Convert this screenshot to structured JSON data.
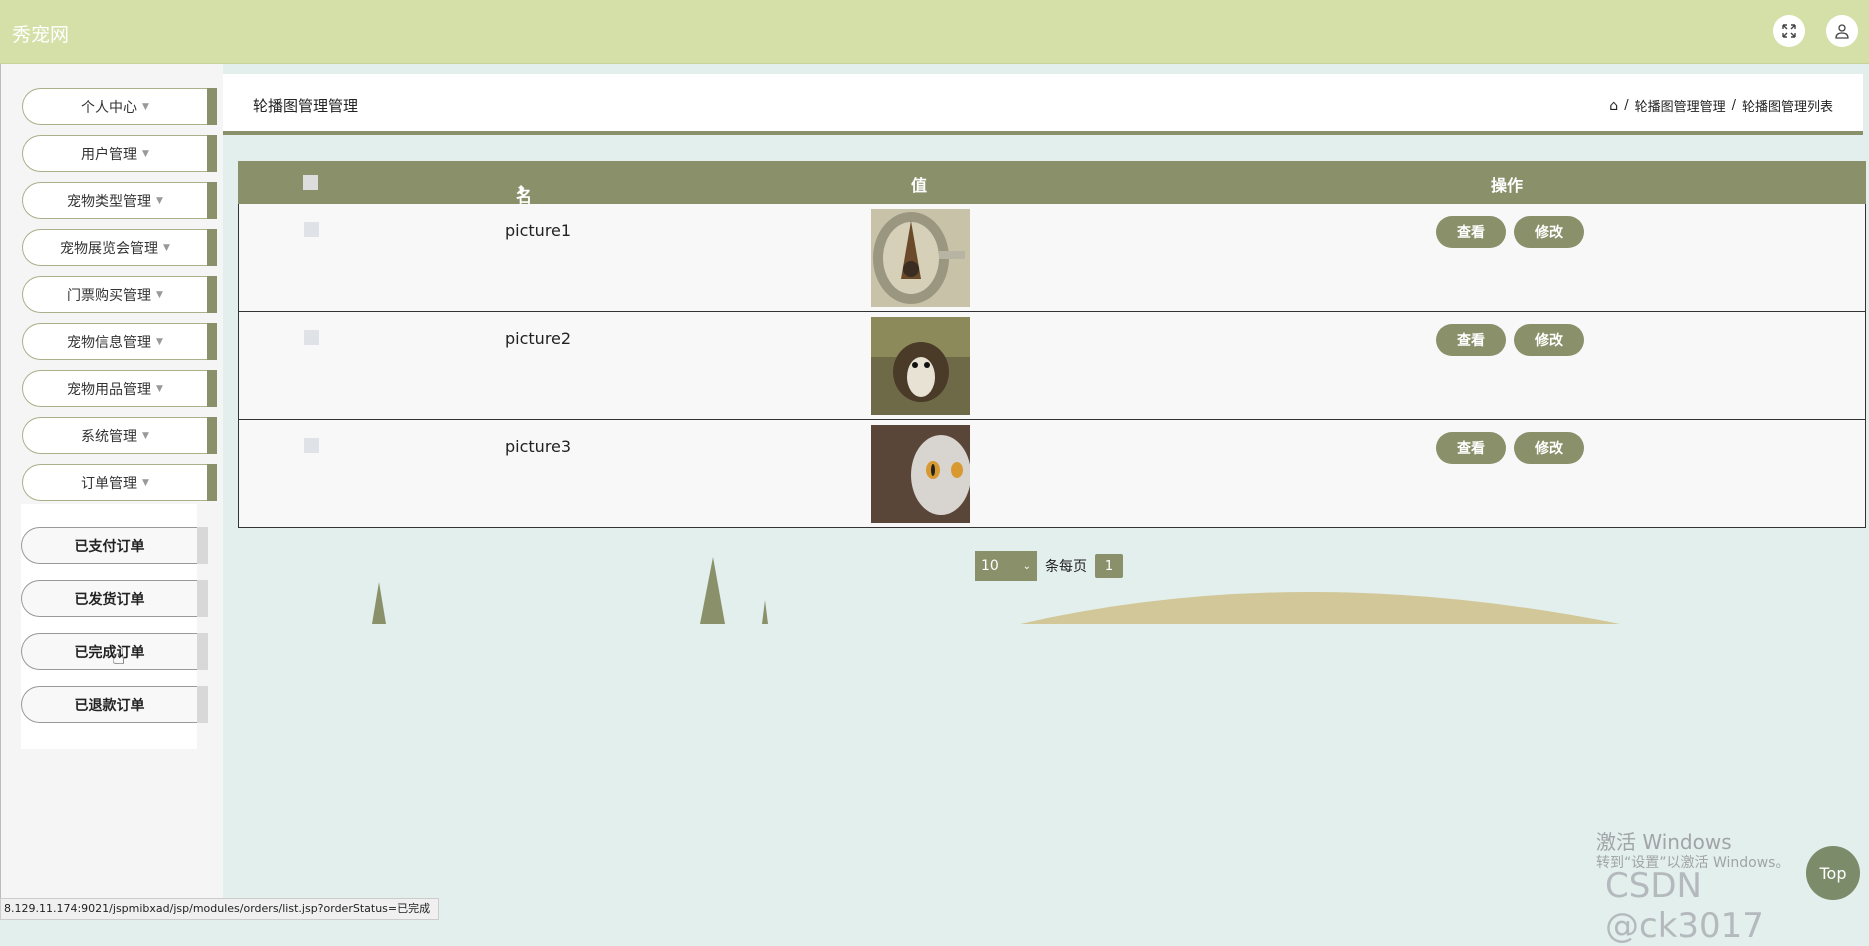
{
  "app": {
    "brand": "秀宠网"
  },
  "topbar": {
    "fullscreen_icon": "fullscreen-icon",
    "user_icon": "user-icon"
  },
  "sidebar": {
    "items": [
      {
        "label": "个人中心"
      },
      {
        "label": "用户管理"
      },
      {
        "label": "宠物类型管理"
      },
      {
        "label": "宠物展览会管理"
      },
      {
        "label": "门票购买管理"
      },
      {
        "label": "宠物信息管理"
      },
      {
        "label": "宠物用品管理"
      },
      {
        "label": "系统管理"
      },
      {
        "label": "订单管理"
      }
    ],
    "subitems": [
      {
        "label": "已支付订单"
      },
      {
        "label": "已发货订单"
      },
      {
        "label": "已完成订单"
      },
      {
        "label": "已退款订单"
      }
    ]
  },
  "header": {
    "title": "轮播图管理管理",
    "breadcrumb": [
      "轮播图管理管理",
      "轮播图管理列表"
    ],
    "separator": "/"
  },
  "table": {
    "columns": [
      "名称",
      "值",
      "操作"
    ],
    "rows": [
      {
        "name": "picture1",
        "view": "查看",
        "edit": "修改"
      },
      {
        "name": "picture2",
        "view": "查看",
        "edit": "修改"
      },
      {
        "name": "picture3",
        "view": "查看",
        "edit": "修改"
      }
    ]
  },
  "pager": {
    "page_size": "10",
    "per_page_label": "条每页",
    "current_page": "1"
  },
  "overlay": {
    "watermark_title": "激活 Windows",
    "watermark_sub": "转到“设置”以激活 Windows。",
    "csdn": "CSDN @ck3017",
    "top_button": "Top",
    "status_url": "8.129.11.174:9021/jspmibxad/jsp/modules/orders/list.jsp?orderStatus=已完成"
  },
  "colors": {
    "topbar": "#d4e0a8",
    "accent": "#8a916a",
    "background": "#e3efec"
  }
}
